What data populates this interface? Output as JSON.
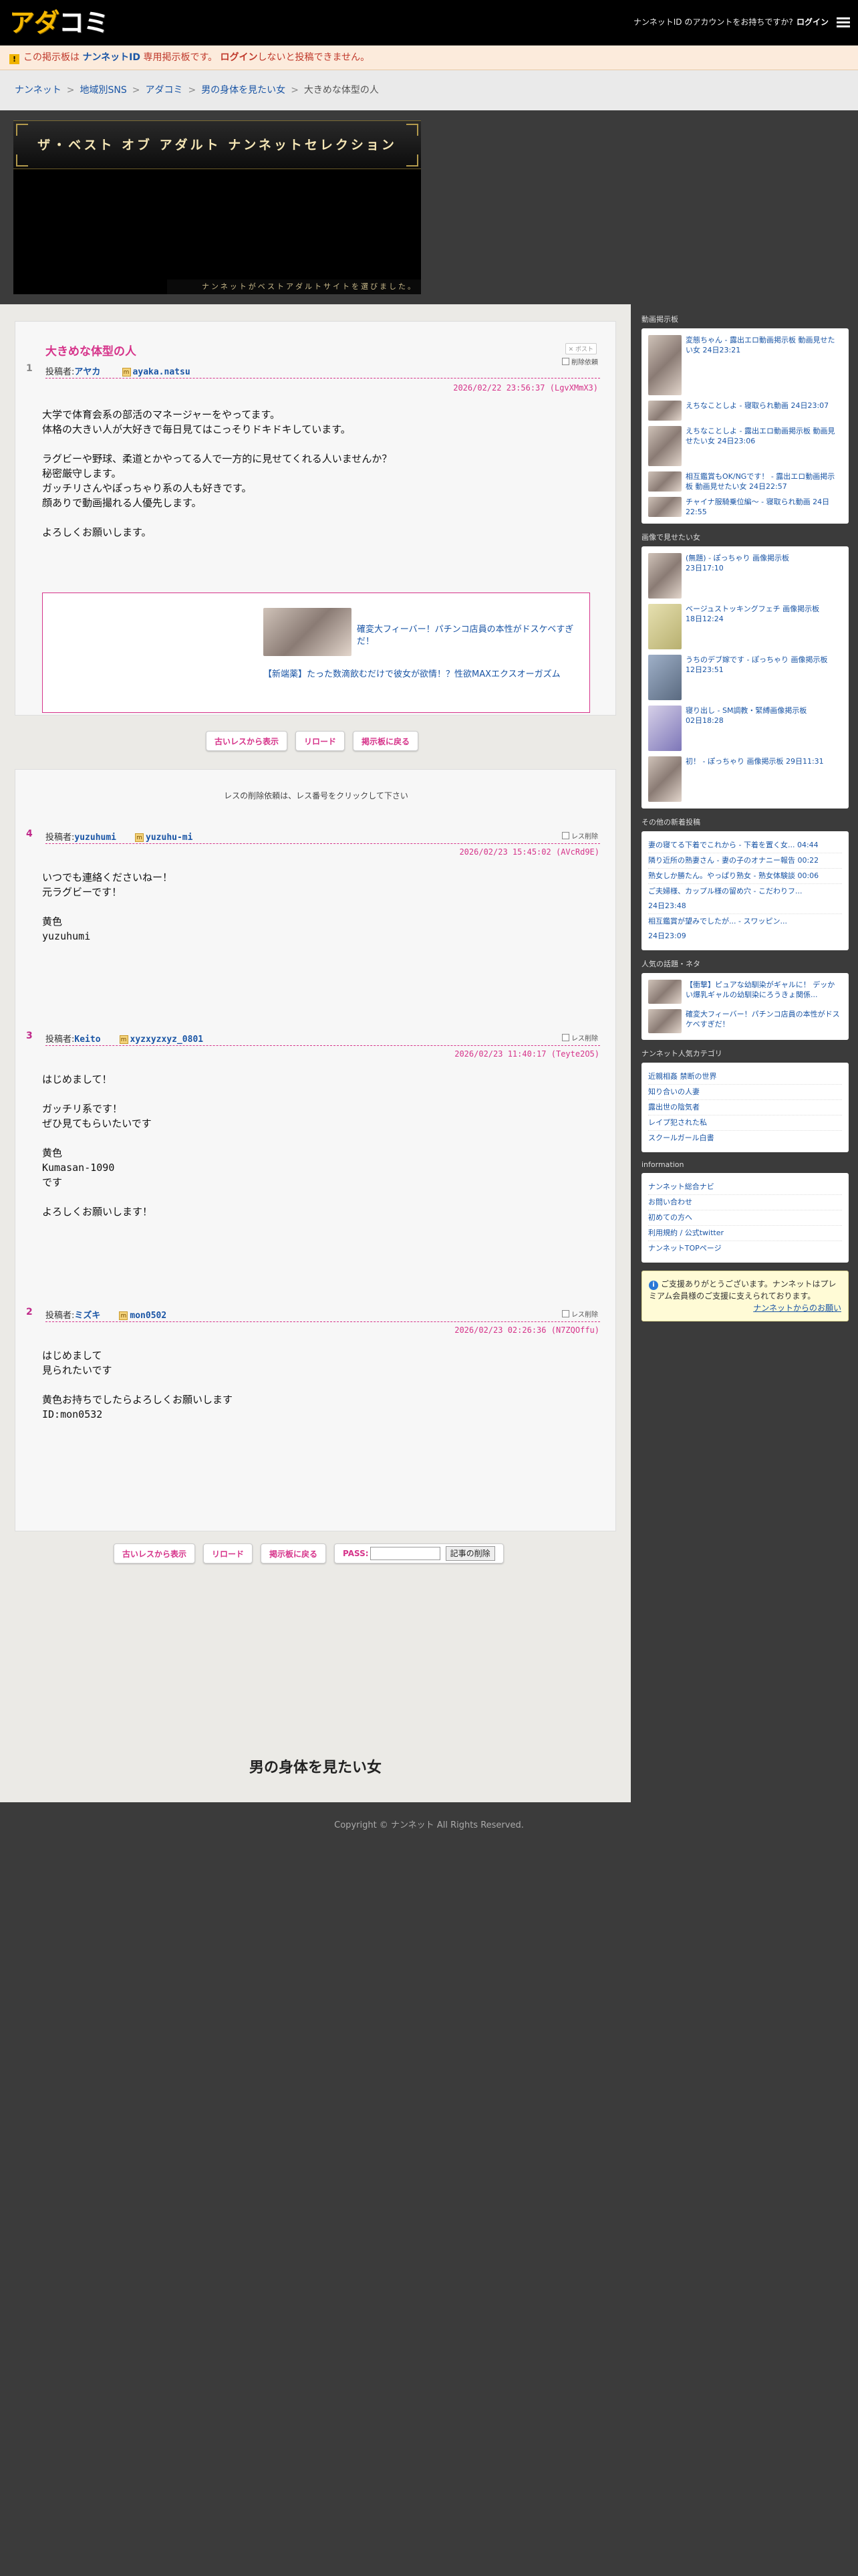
{
  "header": {
    "logo_yellow": "アダ",
    "logo_white": "コミ",
    "account_question": "ナンネットID のアカウントをお持ちですか? ",
    "login_label": "ログイン"
  },
  "notice": {
    "warn_glyph": "!",
    "text_a": "この掲示板は ",
    "text_bold": "ナンネットID",
    "text_b": " 専用掲示板です。 ",
    "login_link": "ログイン",
    "text_c": "しないと投稿できません。"
  },
  "breadcrumb": {
    "items": [
      "ナンネット",
      "地域別SNS",
      "アダコミ",
      "男の身体を見たい女"
    ],
    "current": "大きめな体型の人",
    "separator": ">"
  },
  "banner": {
    "title": "ザ・ベスト オブ アダルト ナンネットセレクション",
    "subtitle": "ナンネットがベストアダルトサイトを選びました。"
  },
  "thread": {
    "title": "大きめな体型の人",
    "share_label": "✕ ポスト",
    "delete_label": "削除依頼",
    "number": "1",
    "poster_prefix": "投稿者:",
    "poster_name": "アヤカ",
    "poster_id": "ayaka.natsu",
    "date": "2026/02/22 23:56:37",
    "hash": "(LgvXMmX3)",
    "body": "大学で体育会系の部活のマネージャーをやってます。\n体格の大きい人が大好きで毎日見てはこっそりドキドキしています。\n\nラグビーや野球、柔道とかやってる人で一方的に見せてくれる人いませんか？\n秘密厳守します。\nガッチリさんやぽっちゃり系の人も好きです。\n顔ありで動画撮れる人優先します。\n\nよろしくお願いします。",
    "ad1": "確変大フィーバー！パチンコ店員の本性がドスケベすぎだ！",
    "ad2": "【新端薬】たった数滴飲むだけで彼女が欲情！？性欲MAXエクスオーガズム"
  },
  "buttons": {
    "old_order": "古いレスから表示",
    "reload": "リロード",
    "back": "掲示板に戻る",
    "pass_label": "PASS:",
    "delete_post": "記事の削除"
  },
  "replies_note": "レスの削除依頼は、レス番号をクリックして下さい",
  "reply_delete_label": "レス削除",
  "replies": [
    {
      "num": "4",
      "name": "yuzuhumi",
      "id": "yuzuhu-mi",
      "date": "2026/02/23 15:45:02",
      "hash": "(AVcRd9E)",
      "body": "いつでも連絡くださいねー！\n元ラグビーです！\n\n黄色\nyuzuhumi"
    },
    {
      "num": "3",
      "name": "Keito",
      "id": "xyzxyzxyz_0801",
      "date": "2026/02/23 11:40:17",
      "hash": "(Teyte2O5)",
      "body": "はじめまして！\n\nガッチリ系です！\nぜひ見てもらいたいです\n\n黄色\nKumasan-1090\nです\n\nよろしくお願いします！"
    },
    {
      "num": "2",
      "name": "ミズキ",
      "id": "mon0502",
      "date": "2026/02/23 02:26:36",
      "hash": "(N7ZQOffu)",
      "body": "はじめまして\n見られたいです\n\n黄色お持ちでしたらよろしくお願いします\nID:mon0532"
    }
  ],
  "footer": {
    "board_title": "男の身体を見たい女",
    "copyright": "Copyright © ナンネット All Rights Reserved."
  },
  "sidebar": {
    "sections": [
      {
        "title": "動画掲示板",
        "items": [
          {
            "text": "変態ちゃん - 露出エロ動画掲示板 動画見せたい女",
            "date": "24日23:21"
          },
          {
            "text": "えちなことしよ - 寝取られ動画",
            "date": "24日23:07"
          },
          {
            "text": "えちなことしよ - 露出エロ動画掲示板 動画見せたい女",
            "date": "24日23:06"
          },
          {
            "text": "相互鑑賞もOK/NGです！ - 露出エロ動画掲示板 動画見せたい女",
            "date": "24日22:57"
          },
          {
            "text": "チャイナ服騎乗位編〜 - 寝取られ動画",
            "date": "24日22:55"
          }
        ]
      },
      {
        "title": "画像で見せたい女",
        "items": [
          {
            "text": "(無題) - ぽっちゃり 画像掲示板",
            "date": "23日17:10"
          },
          {
            "text": "ベージュストッキングフェチ 画像掲示板",
            "date": "18日12:24"
          },
          {
            "text": "うちのデブ嫁です - ぽっちゃり 画像掲示板",
            "date": "12日23:51"
          },
          {
            "text": "寝り出し - SM調教・緊縛画像掲示板",
            "date": "02日18:28"
          },
          {
            "text": "初！ - ぽっちゃり 画像掲示板",
            "date": "29日11:31"
          }
        ]
      }
    ],
    "other_title": "その他の新着投稿",
    "other_links": [
      {
        "text": "妻の寝てる下着でこれから - 下着を置く女...",
        "date": "04:44"
      },
      {
        "text": "隣り近所の熟妻さん - 妻の子のオナニー報告",
        "date": "00:22"
      },
      {
        "text": "熟女しか勝たん。やっぱり熟女 - 熟女体験談",
        "date": "00:06"
      },
      {
        "text": "ご夫婦様、カップル様の留め穴 - こだわりフ...",
        "date": "24日23:48"
      },
      {
        "text": "相互鑑賞が望みでしたが... - スワッピン...",
        "date": "24日23:09"
      }
    ],
    "popular_title": "人気の話題・ネタ",
    "popular": [
      "【衝撃】ピュアな幼馴染がギャルに！ デッかい爆乳ギャルの幼馴染にろうきょ関係...",
      "確変大フィーバー！パチンコ店員の本性がドスケベすぎだ！"
    ],
    "category_title": "ナンネット人気カテゴリ",
    "categories": [
      "近親相姦 禁断の世界",
      "知り合いの人妻",
      "露出世の陰気者",
      "レイプ犯された私",
      "スクールガール白書"
    ],
    "info_title": "information",
    "info_links": [
      "ナンネット総合ナビ",
      "お問い合わせ",
      "初めての方へ",
      "利用規約 / 公式twitter",
      "ナンネットTOPページ"
    ],
    "support_text": "ご支援ありがとうございます。ナンネットはプレミアム会員様のご支援に支えられております。",
    "support_link": "ナンネットからのお願い"
  }
}
